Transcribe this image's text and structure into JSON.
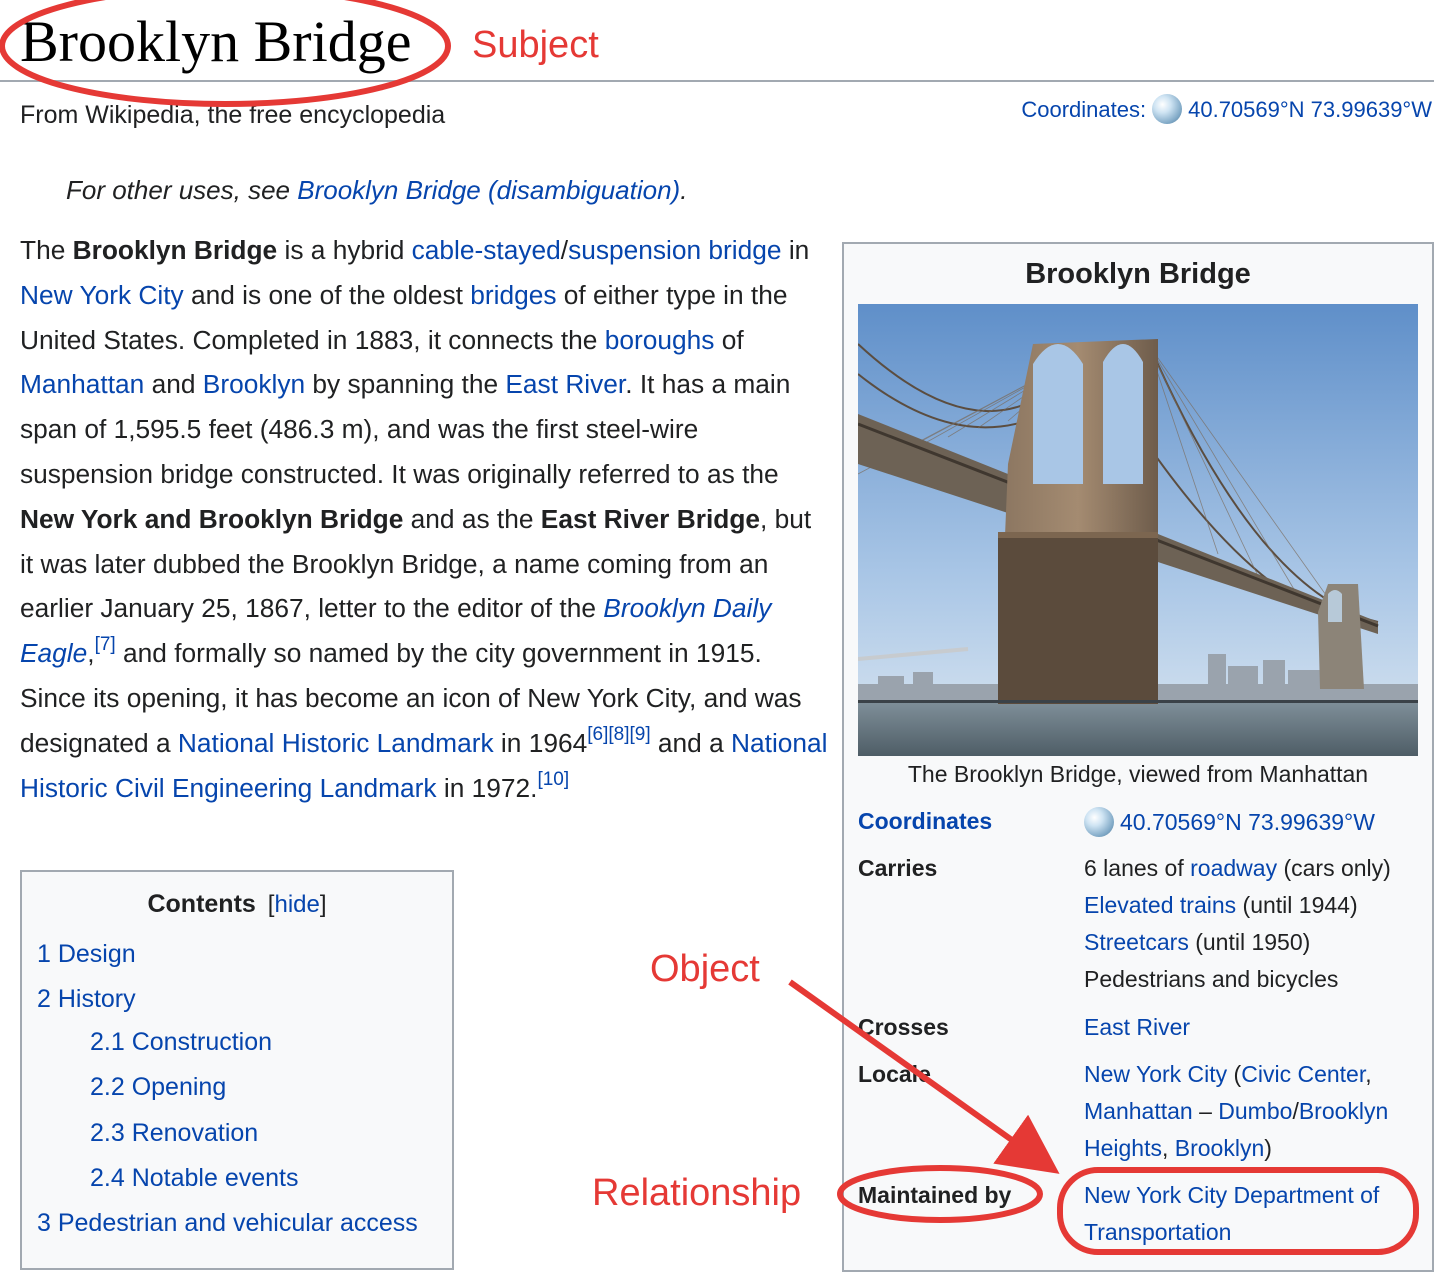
{
  "page": {
    "title": "Brooklyn Bridge",
    "tagline": "From Wikipedia, the free encyclopedia",
    "coordinates_label": "Coordinates:",
    "coordinates_value": "40.70569°N 73.99639°W",
    "hatnote_prefix": "For other uses, see ",
    "hatnote_link": "Brooklyn Bridge (disambiguation)",
    "hatnote_suffix": "."
  },
  "lead": {
    "t1": "The ",
    "b1": "Brooklyn Bridge",
    "t2": " is a hybrid ",
    "l1": "cable-stayed",
    "t3": "/",
    "l2": "suspension bridge",
    "t4": " in ",
    "l3": "New York City",
    "t5": " and is one of the oldest ",
    "l4": "bridges",
    "t6": " of either type in the United States. Completed in 1883, it connects the ",
    "l5": "boroughs",
    "t7": " of ",
    "l6": "Manhattan",
    "t8": " and ",
    "l7": "Brooklyn",
    "t9": " by spanning the ",
    "l8": "East River",
    "t10": ". It has a main span of 1,595.5 feet (486.3 m), and was the first steel-wire suspension bridge constructed. It was originally referred to as the ",
    "b2": "New York and Brooklyn Bridge",
    "t11": " and as the ",
    "b3": "East River Bridge",
    "t12": ", but it was later dubbed the Brooklyn Bridge, a name coming from an earlier January 25, 1867, letter to the editor of the ",
    "l9": "Brooklyn Daily Eagle",
    "t13": ",",
    "s1": "[7]",
    "t14": " and formally so named by the city government in 1915. Since its opening, it has become an icon of New York City, and was designated a ",
    "l10": "National Historic Landmark",
    "t15": " in 1964",
    "s2": "[6][8][9]",
    "t16": " and a ",
    "l11": "National Historic Civil Engineering Landmark",
    "t17": " in 1972.",
    "s3": "[10]"
  },
  "toc": {
    "title": "Contents",
    "toggle_open": "[",
    "toggle": "hide",
    "toggle_close": "]",
    "items": [
      {
        "label": "1 Design"
      },
      {
        "label": "2 History"
      },
      {
        "label": "2.1 Construction"
      },
      {
        "label": "2.2 Opening"
      },
      {
        "label": "2.3 Renovation"
      },
      {
        "label": "2.4 Notable events"
      },
      {
        "label": "3 Pedestrian and vehicular access"
      }
    ]
  },
  "infobox": {
    "title": "Brooklyn Bridge",
    "caption": "The Brooklyn Bridge, viewed from Manhattan",
    "coordinates_label": "Coordinates",
    "coordinates_value": "40.70569°N 73.99639°W",
    "carries_label": "Carries",
    "carries": {
      "a1": "6 lanes of ",
      "a2": "roadway",
      "a3": " (cars only)",
      "b1": "Elevated trains",
      "b2": " (until 1944)",
      "c1": "Streetcars",
      "c2": " (until 1950)",
      "d1": "Pedestrians and bicycles"
    },
    "crosses_label": "Crosses",
    "crosses_value": "East River",
    "locale_label": "Locale",
    "locale": {
      "l1": "New York City",
      "t1": " (",
      "l2": "Civic Center",
      "t2": ",",
      "l3": "Manhattan",
      "t3": " – ",
      "l4": "Dumbo",
      "t4": "/",
      "l5": "Brooklyn",
      "l6": "Heights",
      "t5": ", ",
      "l7": "Brooklyn",
      "t6": ")"
    },
    "maintained_label": "Maintained by",
    "maintained_line1": "New York City Department of",
    "maintained_line2": "Transportation"
  },
  "annotations": {
    "subject": "Subject",
    "object": "Object",
    "relationship": "Relationship",
    "color": "#e53935"
  }
}
